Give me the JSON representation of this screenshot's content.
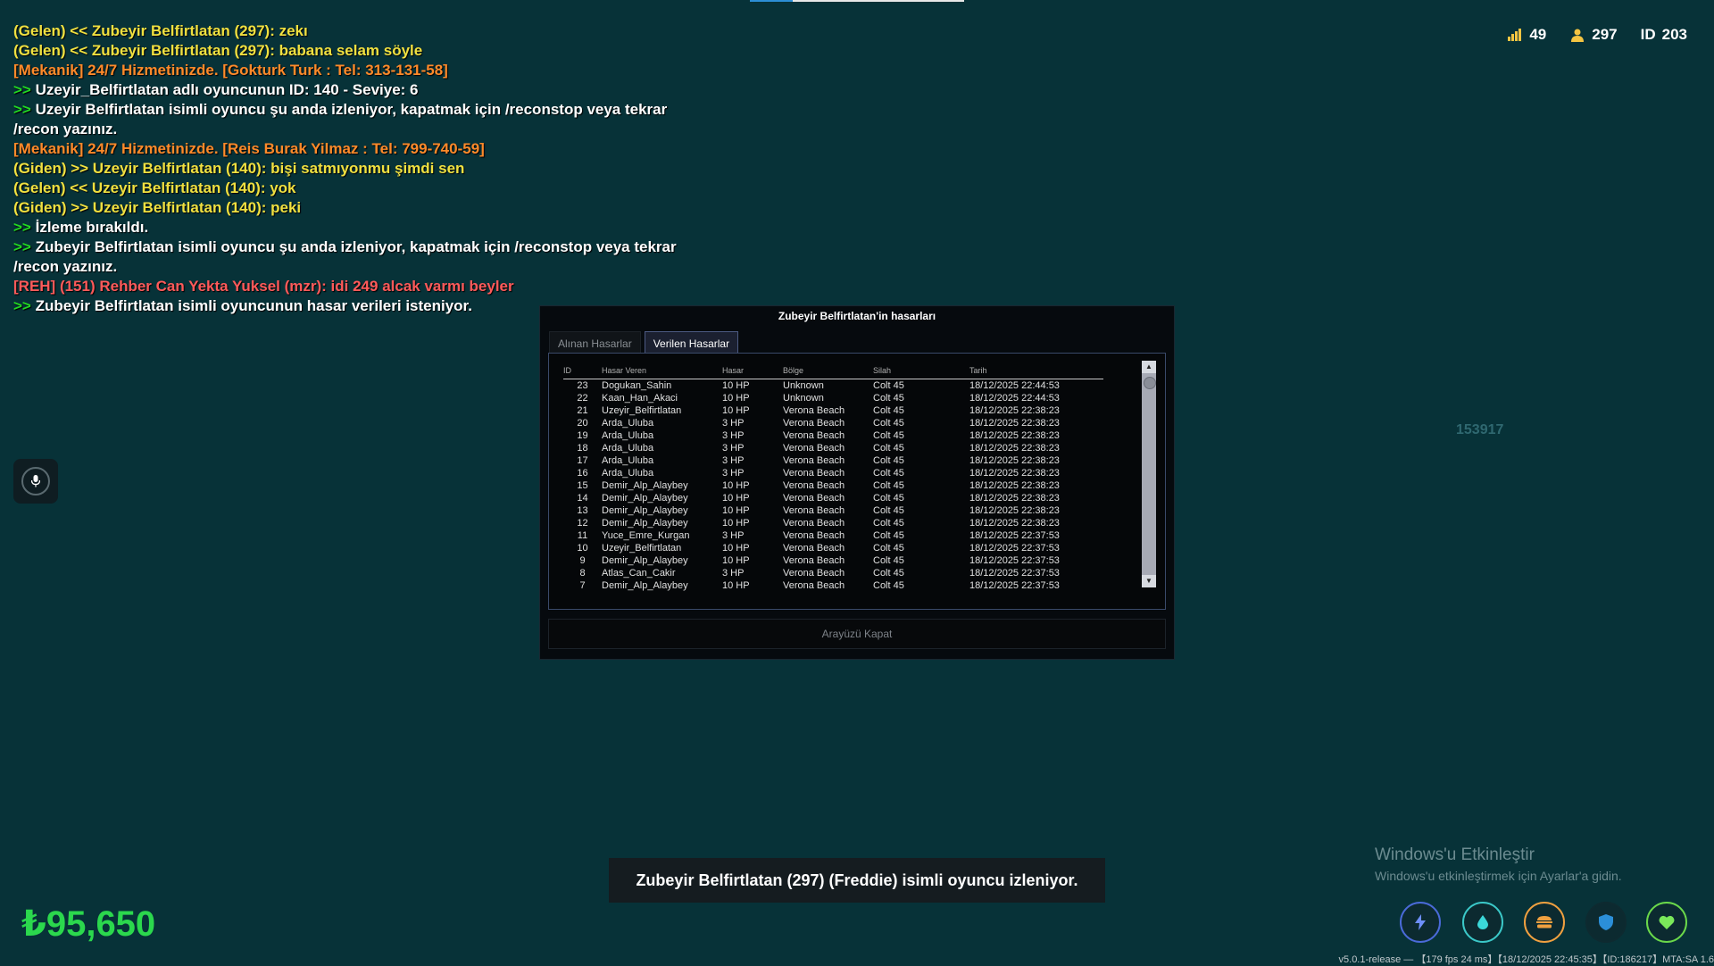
{
  "chat": [
    {
      "prefix": "",
      "text": "(Gelen) << Zubeyir Belfirtlatan (297): zekı",
      "color": "yellow"
    },
    {
      "prefix": "",
      "text": "(Gelen) << Zubeyir Belfirtlatan (297): babana selam söyle",
      "color": "yellow"
    },
    {
      "prefix": "",
      "text": "[Mekanik] 24/7 Hizmetinizde. [Gokturk Turk : Tel: 313-131-58]",
      "color": "orange"
    },
    {
      "prefix": ">>",
      "text": "Uzeyir_Belfirtlatan adlı oyuncunun ID: 140 - Seviye: 6",
      "color": "white"
    },
    {
      "prefix": ">>",
      "text": "Uzeyir Belfirtlatan isimli oyuncu şu anda izleniyor, kapatmak için /reconstop veya tekrar /recon yazınız.",
      "color": "white"
    },
    {
      "prefix": "",
      "text": "[Mekanik] 24/7 Hizmetinizde. [Reis Burak Yilmaz : Tel: 799-740-59]",
      "color": "orange"
    },
    {
      "prefix": "",
      "text": "(Giden) >> Uzeyir Belfirtlatan (140): bişi satmıyonmu şimdi sen",
      "color": "yellow"
    },
    {
      "prefix": "",
      "text": "(Gelen) << Uzeyir Belfirtlatan (140): yok",
      "color": "yellow"
    },
    {
      "prefix": "",
      "text": "(Giden) >> Uzeyir Belfirtlatan (140): peki",
      "color": "yellow"
    },
    {
      "prefix": ">>",
      "text": "İzleme bırakıldı.",
      "color": "white"
    },
    {
      "prefix": ">>",
      "text": "Zubeyir Belfirtlatan isimli oyuncu şu anda izleniyor, kapatmak için /reconstop veya tekrar /recon yazınız.",
      "color": "white"
    },
    {
      "prefix": "",
      "text": "[REH] (151) Rehber Can Yekta Yuksel (mzr): idi 249 alcak varmı beyler",
      "color": "red"
    },
    {
      "prefix": ">>",
      "text": "Zubeyir Belfirtlatan isimli oyuncunun hasar verileri isteniyor.",
      "color": "white"
    }
  ],
  "stats": {
    "ping": "49",
    "players": "297",
    "id_label": "ID",
    "id": "203"
  },
  "ghost_number": "153917",
  "dialog": {
    "title": "Zubeyir Belfirtlatan'in hasarları",
    "tabs": [
      "Alınan Hasarlar",
      "Verilen Hasarlar"
    ],
    "active_tab": 1,
    "columns": [
      "ID",
      "Hasar Veren",
      "Hasar",
      "Bölge",
      "Silah",
      "Tarih"
    ],
    "rows": [
      [
        "23",
        "Dogukan_Sahin",
        "10 HP",
        "Unknown",
        "Colt 45",
        "18/12/2025 22:44:53"
      ],
      [
        "22",
        "Kaan_Han_Akaci",
        "10 HP",
        "Unknown",
        "Colt 45",
        "18/12/2025 22:44:53"
      ],
      [
        "21",
        "Uzeyir_Belfirtlatan",
        "10 HP",
        "Verona Beach",
        "Colt 45",
        "18/12/2025 22:38:23"
      ],
      [
        "20",
        "Arda_Uluba",
        "3 HP",
        "Verona Beach",
        "Colt 45",
        "18/12/2025 22:38:23"
      ],
      [
        "19",
        "Arda_Uluba",
        "3 HP",
        "Verona Beach",
        "Colt 45",
        "18/12/2025 22:38:23"
      ],
      [
        "18",
        "Arda_Uluba",
        "3 HP",
        "Verona Beach",
        "Colt 45",
        "18/12/2025 22:38:23"
      ],
      [
        "17",
        "Arda_Uluba",
        "3 HP",
        "Verona Beach",
        "Colt 45",
        "18/12/2025 22:38:23"
      ],
      [
        "16",
        "Arda_Uluba",
        "3 HP",
        "Verona Beach",
        "Colt 45",
        "18/12/2025 22:38:23"
      ],
      [
        "15",
        "Demir_Alp_Alaybey",
        "10 HP",
        "Verona Beach",
        "Colt 45",
        "18/12/2025 22:38:23"
      ],
      [
        "14",
        "Demir_Alp_Alaybey",
        "10 HP",
        "Verona Beach",
        "Colt 45",
        "18/12/2025 22:38:23"
      ],
      [
        "13",
        "Demir_Alp_Alaybey",
        "10 HP",
        "Verona Beach",
        "Colt 45",
        "18/12/2025 22:38:23"
      ],
      [
        "12",
        "Demir_Alp_Alaybey",
        "10 HP",
        "Verona Beach",
        "Colt 45",
        "18/12/2025 22:38:23"
      ],
      [
        "11",
        "Yuce_Emre_Kurgan",
        "3 HP",
        "Verona Beach",
        "Colt 45",
        "18/12/2025 22:37:53"
      ],
      [
        "10",
        "Uzeyir_Belfirtlatan",
        "10 HP",
        "Verona Beach",
        "Colt 45",
        "18/12/2025 22:37:53"
      ],
      [
        "9",
        "Demir_Alp_Alaybey",
        "10 HP",
        "Verona Beach",
        "Colt 45",
        "18/12/2025 22:37:53"
      ],
      [
        "8",
        "Atlas_Can_Cakir",
        "3 HP",
        "Verona Beach",
        "Colt 45",
        "18/12/2025 22:37:53"
      ],
      [
        "7",
        "Demir_Alp_Alaybey",
        "10 HP",
        "Verona Beach",
        "Colt 45",
        "18/12/2025 22:37:53"
      ]
    ],
    "close_label": "Arayüzü Kapat"
  },
  "banner": "Zubeyir Belfirtlatan (297) (Freddie) isimli oyuncu izleniyor.",
  "windows_activation": {
    "title": "Windows'u Etkinleştir",
    "subtitle": "Windows'u etkinleştirmek için Ayarlar'a gidin."
  },
  "money": "₺95,650",
  "hud_icons": [
    "lightning-icon",
    "water-drop-icon",
    "burger-icon",
    "shield-icon",
    "heart-icon"
  ],
  "footer": "v5.0.1-release — 【179 fps 24 ms】【18/12/2025 22:45:35】【ID:186217】MTA:SA 1.6"
}
